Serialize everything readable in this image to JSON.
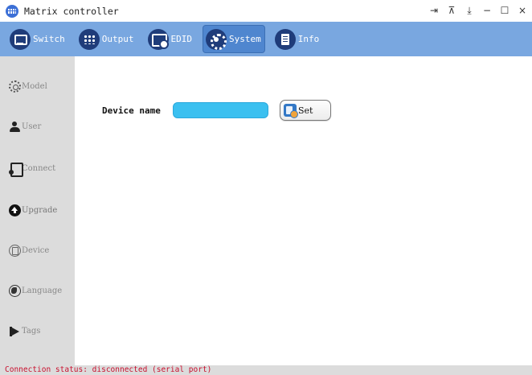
{
  "window": {
    "title": "Matrix controller",
    "app_icon": "matrix-grid-icon",
    "controls": [
      {
        "name": "exit-icon",
        "glyph": "⇥"
      },
      {
        "name": "pin-icon",
        "glyph": "⊼"
      },
      {
        "name": "download-icon",
        "glyph": "⤓"
      },
      {
        "name": "minimize-icon",
        "glyph": "−"
      },
      {
        "name": "maximize-icon",
        "glyph": "☐"
      },
      {
        "name": "close-icon",
        "glyph": "×"
      }
    ]
  },
  "toolbar": {
    "accent": "#79a7e0",
    "active_color": "#4f86cf",
    "items": [
      {
        "label": "Switch",
        "icon": "switch-icon",
        "active": false
      },
      {
        "label": "Output",
        "icon": "output-icon",
        "active": false
      },
      {
        "label": "EDID",
        "icon": "edid-icon",
        "active": false
      },
      {
        "label": "System",
        "icon": "system-icon",
        "active": true
      },
      {
        "label": "Info",
        "icon": "info-icon",
        "active": false
      }
    ]
  },
  "sidebar": {
    "items": [
      {
        "label": "Model",
        "icon": "gear-icon"
      },
      {
        "label": "User",
        "icon": "user-icon"
      },
      {
        "label": "Connect",
        "icon": "connect-icon"
      },
      {
        "label": "Upgrade",
        "icon": "upgrade-icon"
      },
      {
        "label": "Device",
        "icon": "device-icon"
      },
      {
        "label": "Language",
        "icon": "language-icon"
      },
      {
        "label": "Tags",
        "icon": "tags-icon"
      }
    ]
  },
  "main": {
    "device_name_label": "Device name",
    "device_name_value": "",
    "input_color": "#3bc0f0",
    "set_label": "Set"
  },
  "status": {
    "text": "Connection status: disconnected (serial port)",
    "color": "#c8102e"
  }
}
